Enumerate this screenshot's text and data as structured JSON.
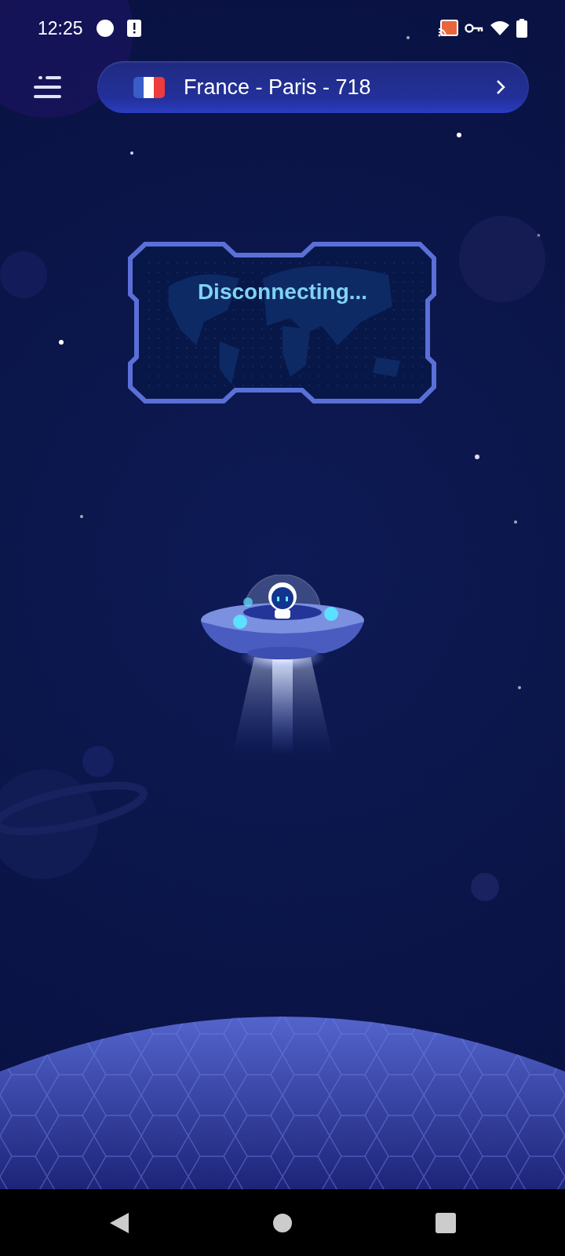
{
  "status_bar": {
    "time": "12:25"
  },
  "server_selector": {
    "label": "France - Paris - 718"
  },
  "connection_panel": {
    "status": "Disconnecting..."
  }
}
